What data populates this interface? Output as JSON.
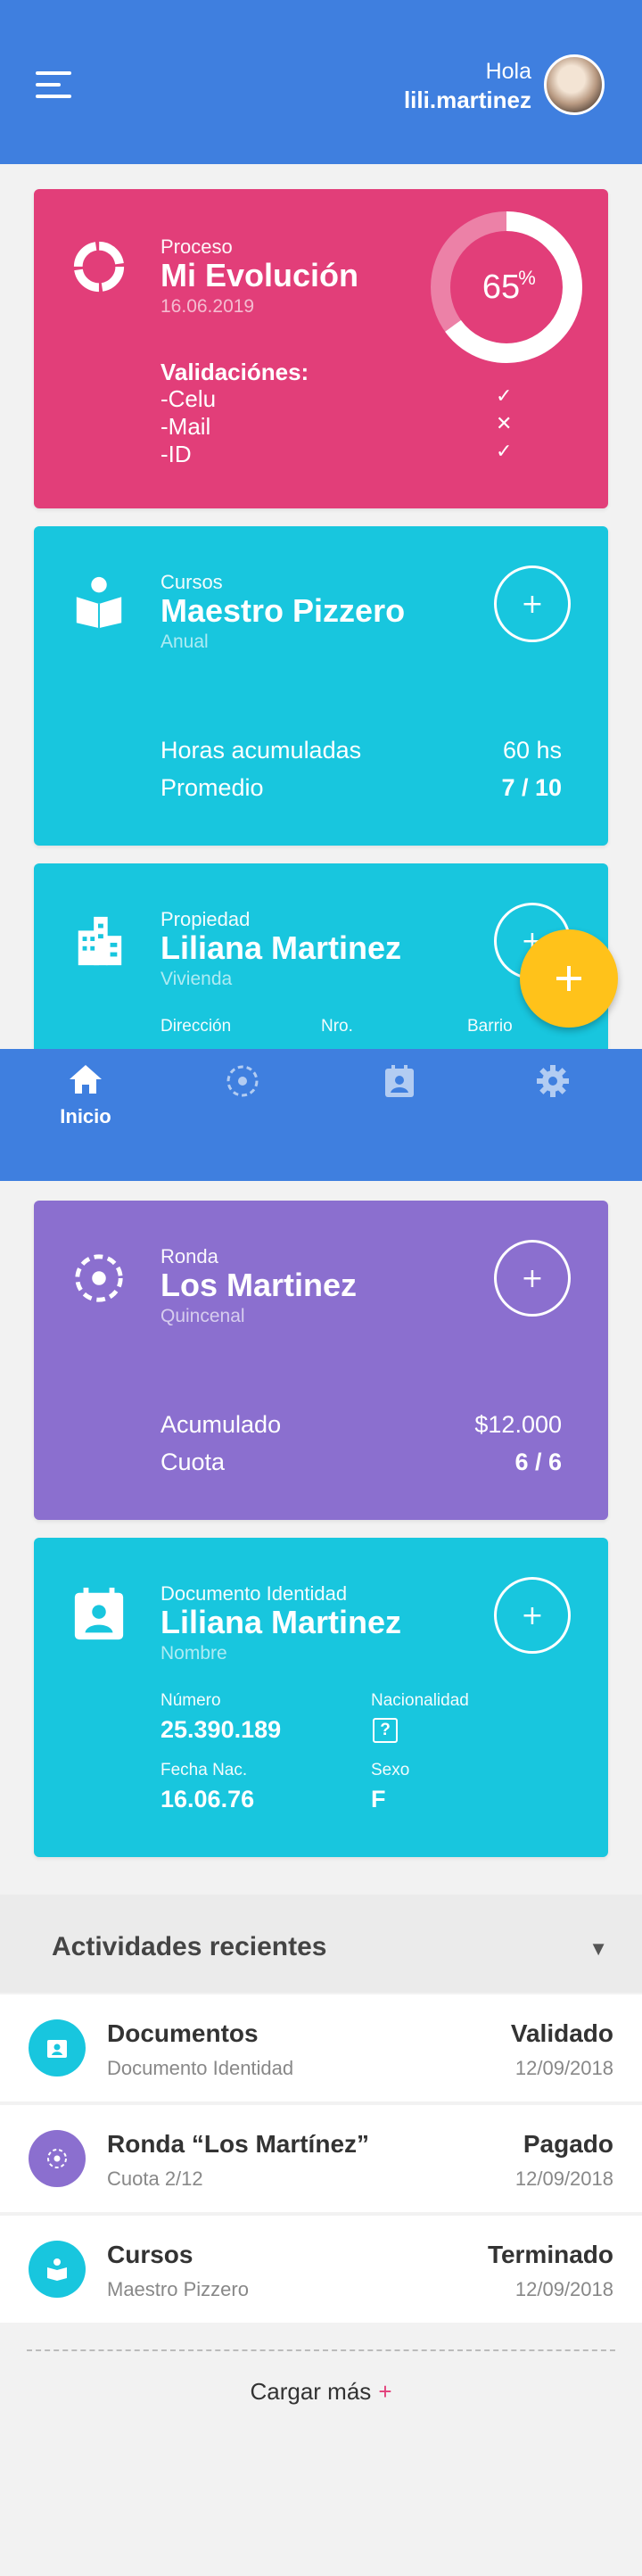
{
  "header": {
    "greeting": "Hola",
    "username": "lili.martinez"
  },
  "evolution_card": {
    "eyebrow": "Proceso",
    "title": "Mi Evolución",
    "date": "16.06.2019",
    "progress_percent": 65,
    "progress_number": "65",
    "progress_symbol": "%",
    "validations_title": "Validaciónes:",
    "validations": [
      {
        "label": "-Celu",
        "status": "✓"
      },
      {
        "label": "-Mail",
        "status": "✕"
      },
      {
        "label": "-ID",
        "status": "✓"
      }
    ]
  },
  "courses_card": {
    "eyebrow": "Cursos",
    "title": "Maestro Pizzero",
    "sub": "Anual",
    "rows": [
      {
        "label": "Horas acumuladas",
        "value": "60 hs"
      },
      {
        "label": "Promedio",
        "value": "7 / 10"
      }
    ]
  },
  "property_card": {
    "eyebrow": "Propiedad",
    "title": "Liliana Martinez",
    "sub": "Vivienda",
    "columns": [
      "Dirección",
      "Nro.",
      "Barrio"
    ]
  },
  "nav": {
    "home": "Inicio"
  },
  "round_card": {
    "eyebrow": "Ronda",
    "title": "Los Martinez",
    "sub": "Quincenal",
    "rows": [
      {
        "label": "Acumulado",
        "value": "$12.000"
      },
      {
        "label": "Cuota",
        "value": "6 / 6"
      }
    ]
  },
  "id_card": {
    "eyebrow": "Documento Identidad",
    "title": "Liliana Martinez",
    "sub": "Nombre",
    "number_label": "Número",
    "number_value": "25.390.189",
    "nationality_label": "Nacionalidad",
    "nationality_value": "?",
    "birth_label": "Fecha Nac.",
    "birth_value": "16.06.76",
    "sex_label": "Sexo",
    "sex_value": "F"
  },
  "recent": {
    "title": "Actividades recientes",
    "caret": "▼",
    "items": [
      {
        "name": "Documentos",
        "detail": "Documento Identidad",
        "status": "Validado",
        "date": "12/09/2018",
        "color": "#18c6de"
      },
      {
        "name": "Ronda “Los Martínez”",
        "detail": "Cuota 2/12",
        "status": "Pagado",
        "date": "12/09/2018",
        "color": "#8b6fcf"
      },
      {
        "name": "Cursos",
        "detail": "Maestro Pizzero",
        "status": "Terminado",
        "date": "12/09/2018",
        "color": "#18c6de"
      }
    ],
    "load_more": "Cargar más",
    "load_more_plus": "+"
  },
  "colors": {
    "header": "#3f7fdf",
    "pink": "#e23e79",
    "cyan": "#18c6de",
    "purple": "#8b6fcf",
    "fab": "#ffc21a"
  },
  "icons": {
    "menu": "hamburger-menu-icon",
    "evolution": "donut-progress-icon",
    "courses": "open-book-person-icon",
    "property": "building-icon",
    "round": "dashed-circle-icon",
    "id": "id-badge-icon",
    "fab": "plus-icon",
    "nav_home": "home-icon",
    "nav_round": "dashed-circle-icon",
    "nav_id": "id-badge-icon",
    "nav_settings": "gear-icon"
  }
}
